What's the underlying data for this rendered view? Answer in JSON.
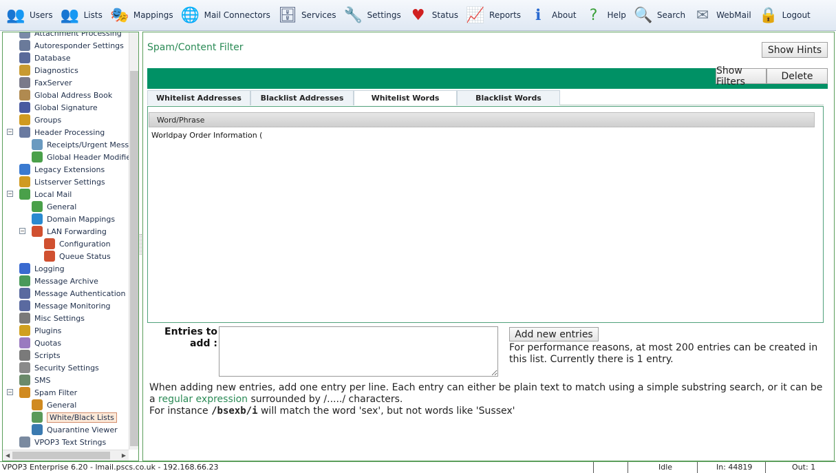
{
  "toolbar": [
    {
      "label": "Users",
      "icon": "users-icon"
    },
    {
      "label": "Lists",
      "icon": "lists-icon"
    },
    {
      "label": "Mappings",
      "icon": "mappings-icon"
    },
    {
      "label": "Mail Connectors",
      "icon": "mail-connectors-icon"
    },
    {
      "label": "Services",
      "icon": "services-icon"
    },
    {
      "label": "Settings",
      "icon": "settings-icon"
    },
    {
      "label": "Status",
      "icon": "status-icon"
    },
    {
      "label": "Reports",
      "icon": "reports-icon"
    },
    {
      "label": "About",
      "icon": "about-icon"
    },
    {
      "label": "Help",
      "icon": "help-icon"
    },
    {
      "label": "Search",
      "icon": "search-icon"
    },
    {
      "label": "WebMail",
      "icon": "webmail-icon"
    },
    {
      "label": "Logout",
      "icon": "logout-icon"
    }
  ],
  "tree": [
    {
      "label": "Attachment Processing",
      "icon": "attachment-icon",
      "color": "#7a8aa8"
    },
    {
      "label": "Autoresponder Settings",
      "icon": "gear-icon",
      "color": "#6a7a9a"
    },
    {
      "label": "Database",
      "icon": "database-icon",
      "color": "#5a6a9a"
    },
    {
      "label": "Diagnostics",
      "icon": "diagnostics-icon",
      "color": "#c89a30"
    },
    {
      "label": "FaxServer",
      "icon": "fax-icon",
      "color": "#7a7a8a"
    },
    {
      "label": "Global Address Book",
      "icon": "address-book-icon",
      "color": "#b08a50"
    },
    {
      "label": "Global Signature",
      "icon": "signature-icon",
      "color": "#4a5aa0"
    },
    {
      "label": "Groups",
      "icon": "groups-icon",
      "color": "#d09a20"
    },
    {
      "label": "Header Processing",
      "icon": "header-icon",
      "color": "#6a7aa0"
    },
    {
      "label": "Receipts/Urgent Messages",
      "icon": "receipt-icon",
      "color": "#6a9ac0"
    },
    {
      "label": "Global Header Modifiers",
      "icon": "header-modifier-icon",
      "color": "#4aa04a"
    },
    {
      "label": "Legacy Extensions",
      "icon": "puzzle-icon",
      "color": "#3a7ad0"
    },
    {
      "label": "Listserver Settings",
      "icon": "listserver-icon",
      "color": "#d09a20"
    },
    {
      "label": "Local Mail",
      "icon": "local-mail-icon",
      "color": "#4aa04a"
    },
    {
      "label": "General",
      "icon": "general-icon",
      "color": "#4aa04a"
    },
    {
      "label": "Domain Mappings",
      "icon": "globe-icon",
      "color": "#2a8ad0"
    },
    {
      "label": "LAN Forwarding",
      "icon": "lan-icon",
      "color": "#d05030"
    },
    {
      "label": "Configuration",
      "icon": "configuration-icon",
      "color": "#d05030"
    },
    {
      "label": "Queue Status",
      "icon": "queue-icon",
      "color": "#d05030"
    },
    {
      "label": "Logging",
      "icon": "logging-icon",
      "color": "#3a6ad0"
    },
    {
      "label": "Message Archive",
      "icon": "archive-icon",
      "color": "#4a9a5a"
    },
    {
      "label": "Message Authentication",
      "icon": "authentication-icon",
      "color": "#5a6aa0"
    },
    {
      "label": "Message Monitoring",
      "icon": "monitoring-icon",
      "color": "#5a6aa0"
    },
    {
      "label": "Misc Settings",
      "icon": "tools-icon",
      "color": "#7a7a7a"
    },
    {
      "label": "Plugins",
      "icon": "plugin-icon",
      "color": "#d0a020"
    },
    {
      "label": "Quotas",
      "icon": "quota-icon",
      "color": "#9a7ac0"
    },
    {
      "label": "Scripts",
      "icon": "script-icon",
      "color": "#7a7a7a"
    },
    {
      "label": "Security Settings",
      "icon": "lock-icon",
      "color": "#8a8a8a"
    },
    {
      "label": "SMS",
      "icon": "phone-icon",
      "color": "#6a8a6a"
    },
    {
      "label": "Spam Filter",
      "icon": "spam-icon",
      "color": "#d08a20"
    },
    {
      "label": "General",
      "icon": "spam-general-icon",
      "color": "#d08a20"
    },
    {
      "label": "White/Black Lists",
      "icon": "notepad-icon",
      "color": "#5a9a5a"
    },
    {
      "label": "Quarantine Viewer",
      "icon": "quarantine-icon",
      "color": "#3a7ab0"
    },
    {
      "label": "VPOP3 Text Strings",
      "icon": "text-strings-icon",
      "color": "#7a8aa0"
    }
  ],
  "main": {
    "title": "Spam/Content Filter",
    "show_hints": "Show Hints",
    "show_filters": "Show Filters",
    "delete": "Delete",
    "tabs": [
      "Whitelist Addresses",
      "Blacklist Addresses",
      "Whitelist Words",
      "Blacklist Words"
    ],
    "active_tab": "Whitelist Words",
    "list_header": "Word/Phrase",
    "rows": [
      "Worldpay Order Information ("
    ],
    "entries_label": "Entries to add :",
    "entries_value": "",
    "add_button": "Add new entries",
    "perf_note": "For performance reasons, at most 200 entries can be created in this list. Currently there is 1 entry.",
    "help_line1": "When adding new entries, add one entry per line. Each entry can either be plain text to match using a simple substring search, or it can be a",
    "help_link": "regular expression",
    "help_line1b": "surrounded by /...../ characters.",
    "help_line2a": "For instance",
    "help_code": "/bsexb/i",
    "help_line2b": "will match the word 'sex', but not words like 'Sussex'"
  },
  "status": {
    "app": "VPOP3 Enterprise 6.20 - lmail.pscs.co.uk - 192.168.66.23",
    "state": "Idle",
    "in": "In: 44819",
    "out": "Out: 1"
  },
  "colors": {
    "accent_green": "#009165",
    "title_green": "#2a8a55"
  }
}
